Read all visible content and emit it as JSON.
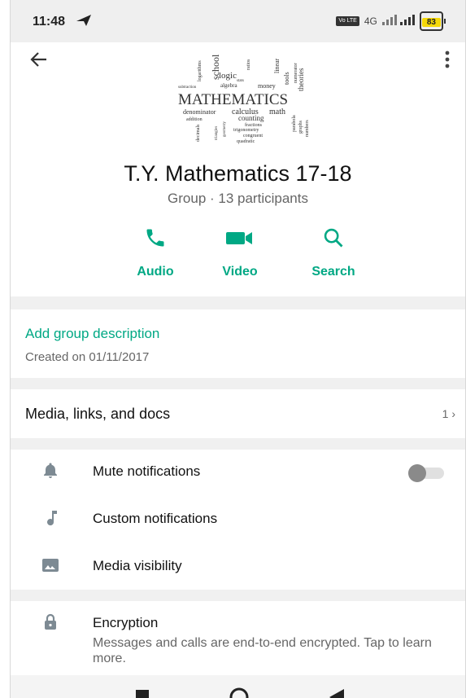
{
  "status_bar": {
    "time": "11:48",
    "network": "4G",
    "volte": "Vo LTE",
    "battery": "83"
  },
  "header": {
    "title": "T.Y. Mathematics 17-18",
    "subtitle": "Group · 13 participants",
    "cloud_words": [
      "MATHEMATICS",
      "school",
      "logic",
      "algebra",
      "money",
      "calculus",
      "math",
      "denominator",
      "addition",
      "counting",
      "fractions",
      "trigonometry",
      "congruent",
      "quadratic",
      "theories",
      "tools",
      "numbers",
      "graphs",
      "linear",
      "ratios",
      "stats",
      "subtraction",
      "logarithms",
      "decimals",
      "triangles",
      "parabola",
      "geometry",
      "numerator"
    ]
  },
  "actions": [
    {
      "label": "Audio",
      "icon": "phone-icon"
    },
    {
      "label": "Video",
      "icon": "videocam-icon"
    },
    {
      "label": "Search",
      "icon": "search-icon"
    }
  ],
  "description": {
    "add_label": "Add group description",
    "created": "Created on 01/11/2017"
  },
  "media": {
    "label": "Media, links, and docs",
    "count": "1"
  },
  "settings": {
    "mute": "Mute notifications",
    "custom": "Custom notifications",
    "visibility": "Media visibility",
    "encryption_title": "Encryption",
    "encryption_sub": "Messages and calls are end-to-end encrypted. Tap to learn more."
  },
  "colors": {
    "accent": "#00a884",
    "divider": "#f0f0f0",
    "battery": "#f5d90a"
  }
}
